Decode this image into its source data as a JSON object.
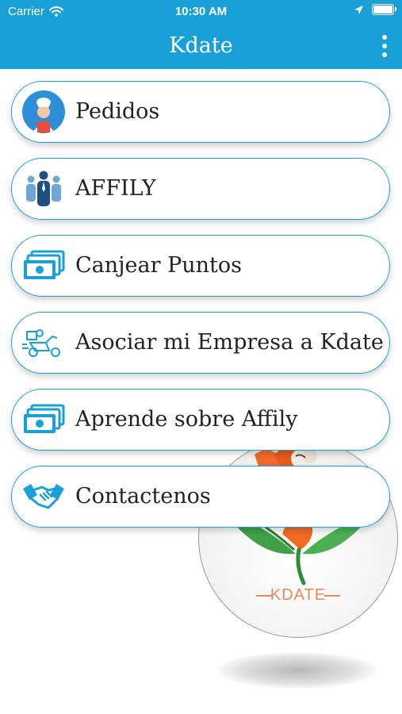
{
  "status_bar": {
    "carrier": "Carrier",
    "time": "10:30 AM"
  },
  "nav": {
    "title": "Kdate"
  },
  "menu": {
    "items": [
      {
        "label": "Pedidos",
        "icon": "chef-avatar-icon"
      },
      {
        "label": "AFFILY",
        "icon": "people-group-icon"
      },
      {
        "label": "Canjear Puntos",
        "icon": "money-stack-icon"
      },
      {
        "label": "Asociar mi Empresa a Kdate",
        "icon": "delivery-scooter-icon"
      },
      {
        "label": "Aprende sobre Affily",
        "icon": "money-stack-icon"
      },
      {
        "label": "Contactenos",
        "icon": "handshake-icon"
      }
    ]
  },
  "logo": {
    "text": "KDATE"
  },
  "colors": {
    "primary": "#1aa0d9",
    "accent": "#e9885b"
  }
}
